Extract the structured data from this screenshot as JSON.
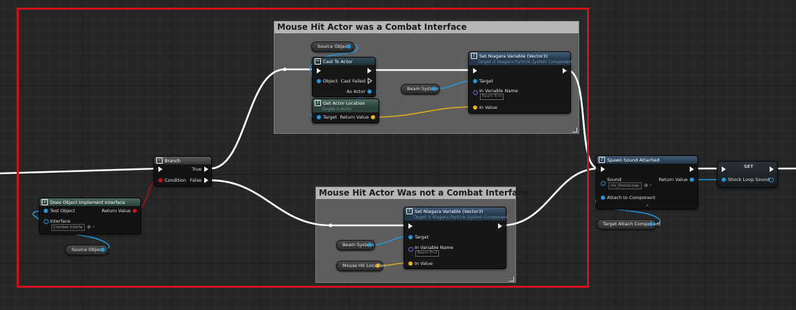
{
  "colors": {
    "exec_wire": "#ffffff",
    "object_pin": "#1f9be0",
    "vector_pin": "#f0b418",
    "bool_pin": "#c21515",
    "name_pin": "#8a62d0",
    "selection_border": "#d0131b",
    "comment_header": "#b5b5b5",
    "comment_body": "#5e5e5e"
  },
  "comments": {
    "combat": {
      "title": "Mouse Hit Actor was a Combat Interface"
    },
    "not_combat": {
      "title": "Mouse Hit Actor Was not a Combat Interface"
    }
  },
  "nodes": {
    "branch": {
      "title": "Branch",
      "icon": "branch-icon",
      "true_label": "True",
      "false_label": "False",
      "condition_label": "Condition"
    },
    "does_implement": {
      "title": "Does Object Implement Interface",
      "icon": "function-icon",
      "test_object": "Test Object",
      "return_value": "Return Value",
      "interface_label": "Interface",
      "interface_value": "Combat Interfa"
    },
    "cast": {
      "title": "Cast To Actor",
      "icon": "cast-icon",
      "object_label": "Object",
      "cast_failed": "Cast Failed",
      "as_actor": "As Actor"
    },
    "get_location": {
      "title": "Get Actor Location",
      "subtitle": "Target is Actor",
      "icon": "function-icon",
      "target": "Target",
      "return_value": "Return Value"
    },
    "set_niagara_1": {
      "title": "Set Niagara Variable (Vector3)",
      "subtitle": "Target is Niagara Particle System Component",
      "icon": "function-icon",
      "target": "Target",
      "in_var_name": "In Variable Name",
      "in_var_value": "Beam End",
      "in_value": "In Value"
    },
    "set_niagara_2": {
      "title": "Set Niagara Variable (Vector3)",
      "subtitle": "Target is Niagara Particle System Component",
      "icon": "function-icon",
      "target": "Target",
      "in_var_name": "In Variable Name",
      "in_var_value": "Beam End",
      "in_value": "In Value"
    },
    "spawn_sound": {
      "title": "Spawn Sound Attached",
      "icon": "function-icon",
      "sound_label": "Sound",
      "sound_value": "sfx_ShockLoop",
      "return_value": "Return Value",
      "attach_label": "Attach to Component"
    },
    "set_var": {
      "title": "SET",
      "pin_label": "Shock Loop Sound"
    }
  },
  "variables": {
    "source_object_top": "Source Object",
    "source_object_bottom": "Source Object",
    "beam_system_top": "Beam System",
    "beam_system_bottom": "Beam System",
    "mouse_hit_location": "Mouse Hit Location",
    "target_attach": "Target Attach Component"
  }
}
